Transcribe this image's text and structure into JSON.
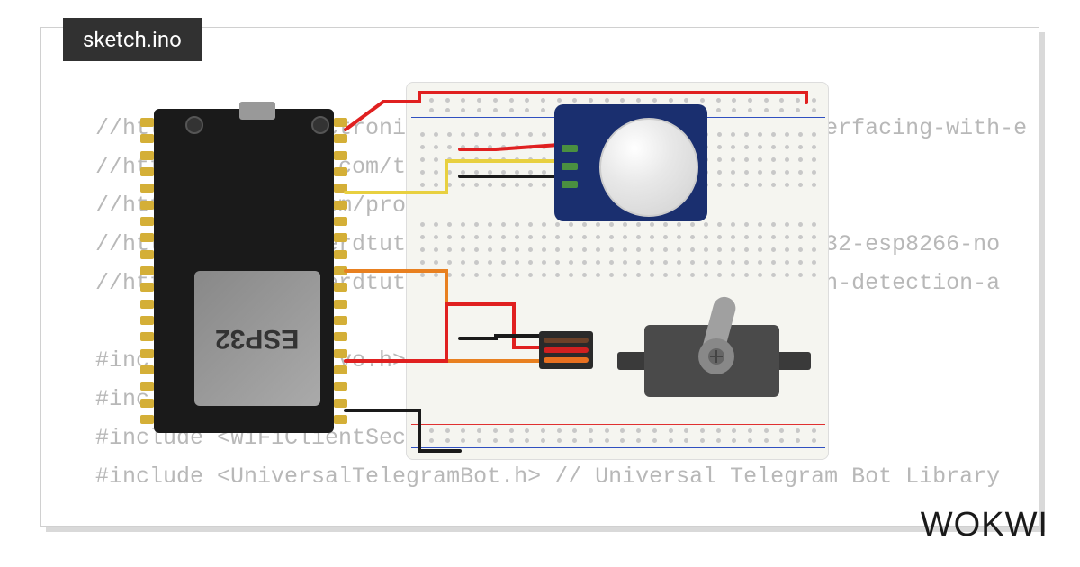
{
  "filename": "sketch.ino",
  "code_lines": [
    "//https://www.electronicwings.com/esp32/pir-sensor-interfacing-with-e",
    "//https://esp32io.com/tutorials/esp32-servo-motor",
    "//https://wokwi.com/projects/383783511635095553  0",
    "//https://randomnerdtutorials.com/telegram-control-esp32-esp8266-no",
    "//https://randomnerdtutorials.com/telegram-esp32-motion-detection-a",
    "",
    "#include <ESP32Servo.h>",
    "#include <WiFi.h>",
    "#include <WiFiClientSecure.h>",
    "#include <UniversalTelegramBot.h>    // Universal Telegram Bot Library"
  ],
  "components": {
    "mcu": "ESP32",
    "sensor": "PIR",
    "actuator": "Servo"
  },
  "branding": "WOKWI"
}
